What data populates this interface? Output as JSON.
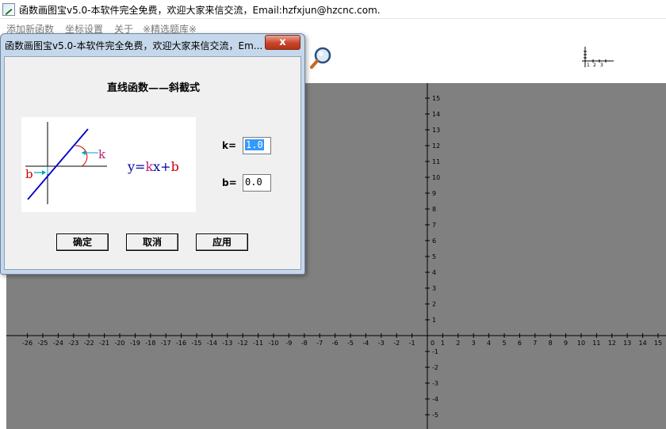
{
  "window": {
    "title": "函数画图宝v5.0-本软件完全免费，欢迎大家来信交流，Email:hzfxjun@hzcnc.com."
  },
  "menu": {
    "items": [
      {
        "label": "添加新函数"
      },
      {
        "label": "坐标设置"
      },
      {
        "label": "关于"
      },
      {
        "label": "※精选题库※"
      }
    ]
  },
  "toolbar": {
    "zoom_icon": "magnifier-icon",
    "mini_axis_labels": [
      "1",
      "2",
      "3"
    ]
  },
  "graph": {
    "x_ticks_negative": [
      "-26",
      "-25",
      "-24",
      "-23",
      "-22",
      "-21",
      "-20",
      "-19",
      "-18",
      "-17",
      "-16",
      "-15",
      "-14",
      "-13",
      "-12",
      "-11",
      "-10",
      "-9",
      "-8",
      "-7",
      "-6",
      "-5",
      "-4",
      "-3",
      "-2",
      "-1"
    ],
    "x_ticks_positive": [
      "0",
      "1",
      "2",
      "3",
      "4",
      "5",
      "6",
      "7",
      "8",
      "9",
      "10",
      "11",
      "12",
      "13",
      "14",
      "15"
    ],
    "y_ticks_positive": [
      "15",
      "14",
      "13",
      "12",
      "11",
      "10",
      "9",
      "8",
      "7",
      "6",
      "5",
      "4",
      "3",
      "2",
      "1"
    ],
    "y_ticks_negative": [
      "-1",
      "-2",
      "-3",
      "-4",
      "-5"
    ],
    "background": "#808080",
    "axis_color": "#000000"
  },
  "dialog": {
    "title": "函数画图宝v5.0-本软件完全免费，欢迎大家来信交流，Em...",
    "close_label": "x",
    "heading": "直线函数——斜截式",
    "figure": {
      "equation_prefix": "y=",
      "equation_k": "k",
      "equation_mid": "x+",
      "equation_b": "b",
      "label_k": "k",
      "label_b": "b"
    },
    "fields": {
      "k_label": "k=",
      "k_value": "1.0",
      "b_label": "b=",
      "b_value": "0.0"
    },
    "buttons": {
      "ok": "确定",
      "cancel": "取消",
      "apply": "应用"
    }
  }
}
